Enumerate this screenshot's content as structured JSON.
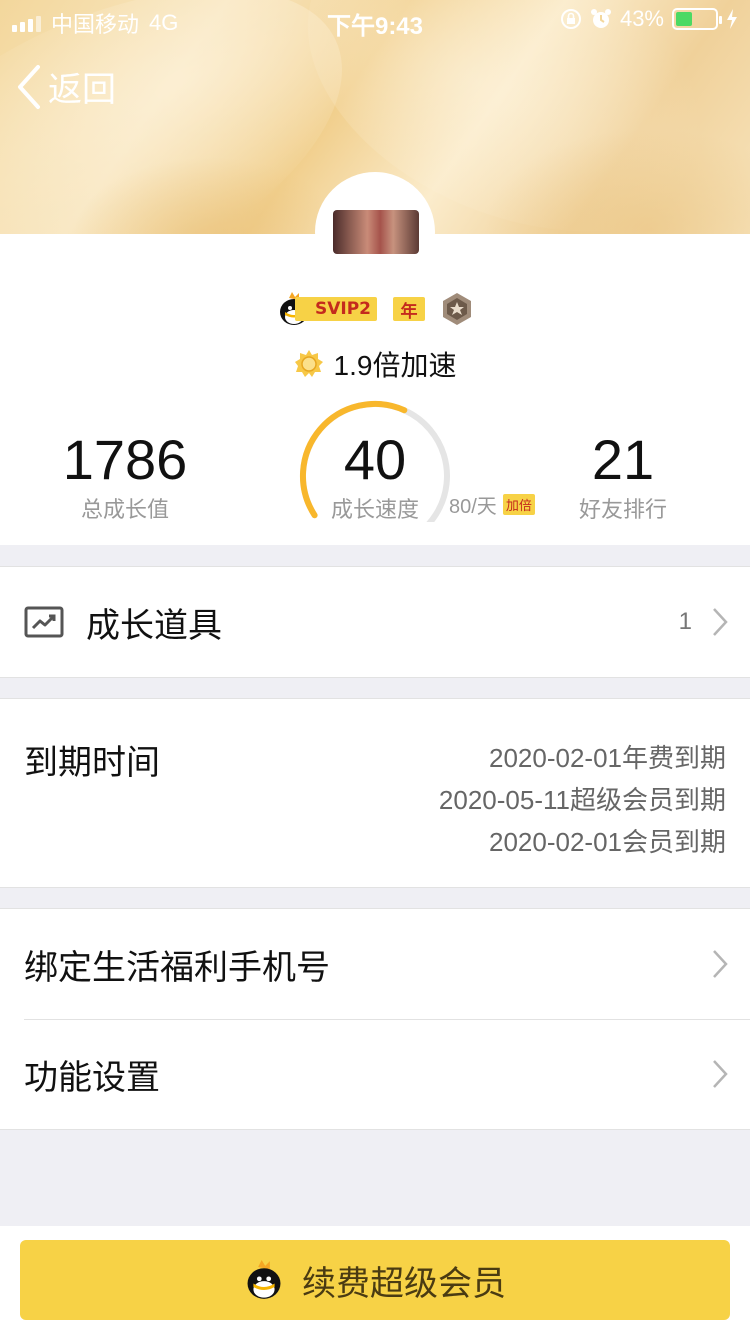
{
  "status_bar": {
    "carrier": "中国移动",
    "network": "4G",
    "time": "下午9:43",
    "battery_percent": "43%",
    "battery_level": 0.43,
    "battery_color": "#4cd964"
  },
  "nav": {
    "back_label": "返回"
  },
  "profile": {
    "svip_label": "SVIP2",
    "year_label": "年",
    "speedup_text": "1.9倍加速"
  },
  "stats": {
    "total_growth": {
      "value": "1786",
      "label": "总成长值"
    },
    "growth_speed": {
      "value": "40",
      "label": "成长速度",
      "progress": 0.5
    },
    "rate": "80/天",
    "rate_badge": "加倍",
    "friend_rank": {
      "value": "21",
      "label": "好友排行"
    }
  },
  "growth_tools": {
    "label": "成长道具",
    "count": "1"
  },
  "expiry": {
    "label": "到期时间",
    "dates": [
      "2020-02-01年费到期",
      "2020-05-11超级会员到期",
      "2020-02-01会员到期"
    ]
  },
  "settings": {
    "bind_phone_label": "绑定生活福利手机号",
    "feature_settings_label": "功能设置"
  },
  "footer": {
    "renew_label": "续费超级会员"
  },
  "colors": {
    "accent": "#f7d246",
    "gauge": "#f8b72c"
  }
}
